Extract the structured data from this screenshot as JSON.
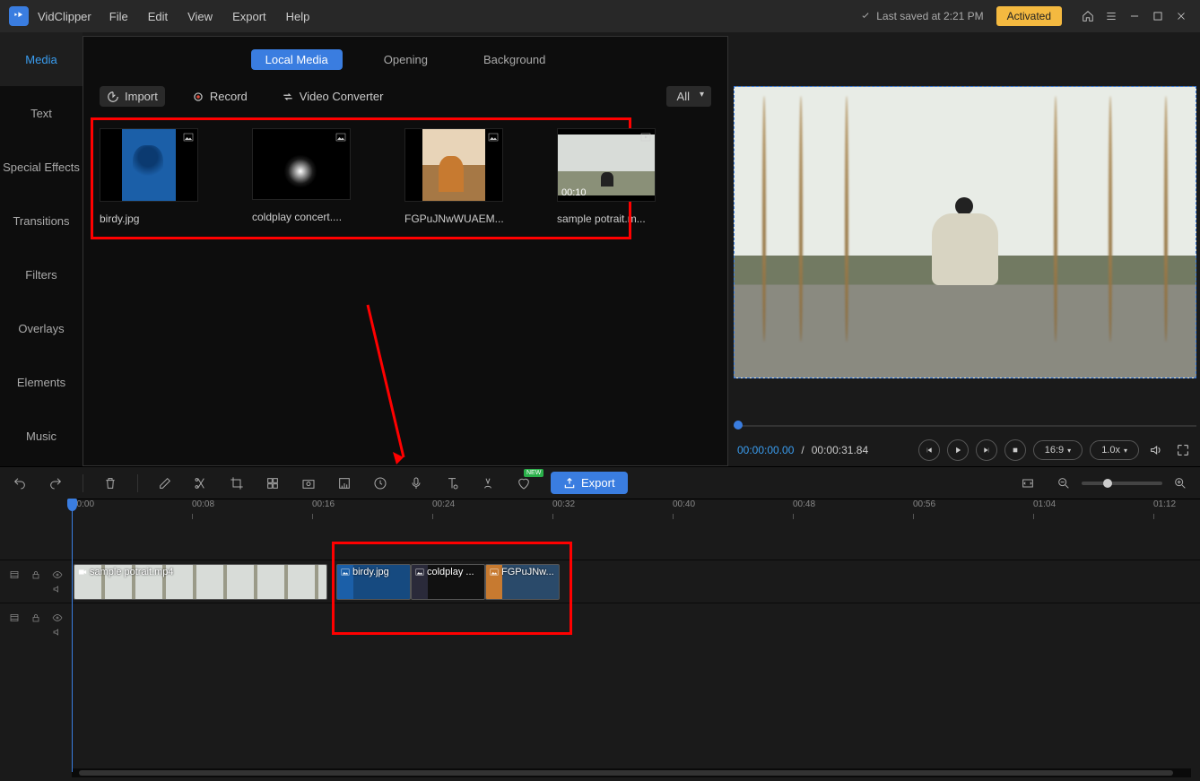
{
  "app": {
    "name": "VidClipper"
  },
  "menu": [
    "File",
    "Edit",
    "View",
    "Export",
    "Help"
  ],
  "status": {
    "saved": "Last saved at 2:21 PM",
    "activated": "Activated"
  },
  "sidebar": [
    "Media",
    "Text",
    "Special Effects",
    "Transitions",
    "Filters",
    "Overlays",
    "Elements",
    "Music"
  ],
  "mediaTabs": [
    "Local Media",
    "Opening",
    "Background"
  ],
  "mediaTools": {
    "import": "Import",
    "record": "Record",
    "conv": "Video Converter",
    "filter": "All"
  },
  "mediaItems": [
    {
      "label": "birdy.jpg",
      "type": "image"
    },
    {
      "label": "coldplay concert....",
      "type": "image"
    },
    {
      "label": "FGPuJNwWUAEM...",
      "type": "image"
    },
    {
      "label": "sample potrait.m...",
      "type": "video",
      "dur": "00:10"
    }
  ],
  "preview": {
    "cur": "00:00:00.00",
    "sep": " / ",
    "total": "00:00:31.84",
    "ratio": "16:9",
    "speed": "1.0x"
  },
  "toolbar": {
    "export": "Export",
    "new": "NEW"
  },
  "ruler": [
    "00:00",
    "00:08",
    "00:16",
    "00:24",
    "00:32",
    "00:40",
    "00:48",
    "00:56",
    "01:04",
    "01:12"
  ],
  "clips": {
    "video": "sample potrait.mp4",
    "imgs": [
      "birdy.jpg",
      "coldplay ...",
      "FGPuJNw..."
    ]
  }
}
